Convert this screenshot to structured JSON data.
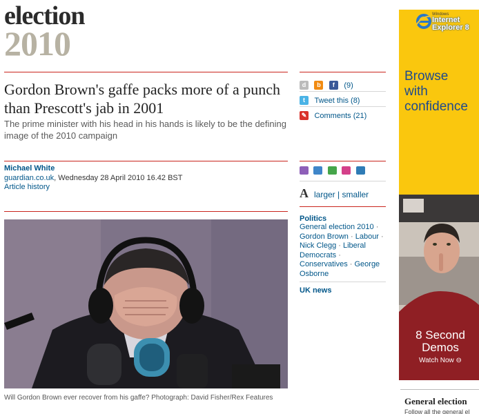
{
  "masthead": {
    "word": "election",
    "year": "2010"
  },
  "article": {
    "headline": "Gordon Brown's gaffe packs more of a punch than Prescott's jab in 2001",
    "standfirst": "The prime minister with his head in his hands is likely to be the defining image of the 2010 campaign",
    "author": "Michael White",
    "source": "guardian.co.uk",
    "date": ", Wednesday 28 April 2010 16.42 BST",
    "history_link": "Article history",
    "caption": "Will Gordon Brown ever recover from his gaffe? Photograph: David Fisher/Rex Features"
  },
  "share": {
    "facebook_count": "(9)",
    "tweet_label": "Tweet this (8)",
    "comments_label": "Comments (21)"
  },
  "font_tools": {
    "a_glyph": "A",
    "larger": "larger",
    "separator": " | ",
    "smaller": "smaller"
  },
  "related": {
    "section": "Politics",
    "tags": [
      "General election 2010",
      "Gordon Brown",
      "Labour",
      "Nick Clegg",
      "Liberal Democrats",
      "Conservatives",
      "George Osborne"
    ],
    "separator": " · ",
    "uk_news": "UK news"
  },
  "ad": {
    "ie_small": "Windows",
    "ie_line1": "Internet",
    "ie_line2": "Explorer 8",
    "browse1": "Browse",
    "browse2": "with",
    "browse3": "confidence",
    "demos1": "8 Second",
    "demos2": "Demos",
    "watch": "Watch Now ⊖"
  },
  "sidebar_bottom": {
    "heading": "General election",
    "sub": "Follow all the general el"
  },
  "colors": {
    "accent_red": "#c9231c",
    "link_blue": "#005689",
    "ad_yellow": "#fac70e"
  }
}
